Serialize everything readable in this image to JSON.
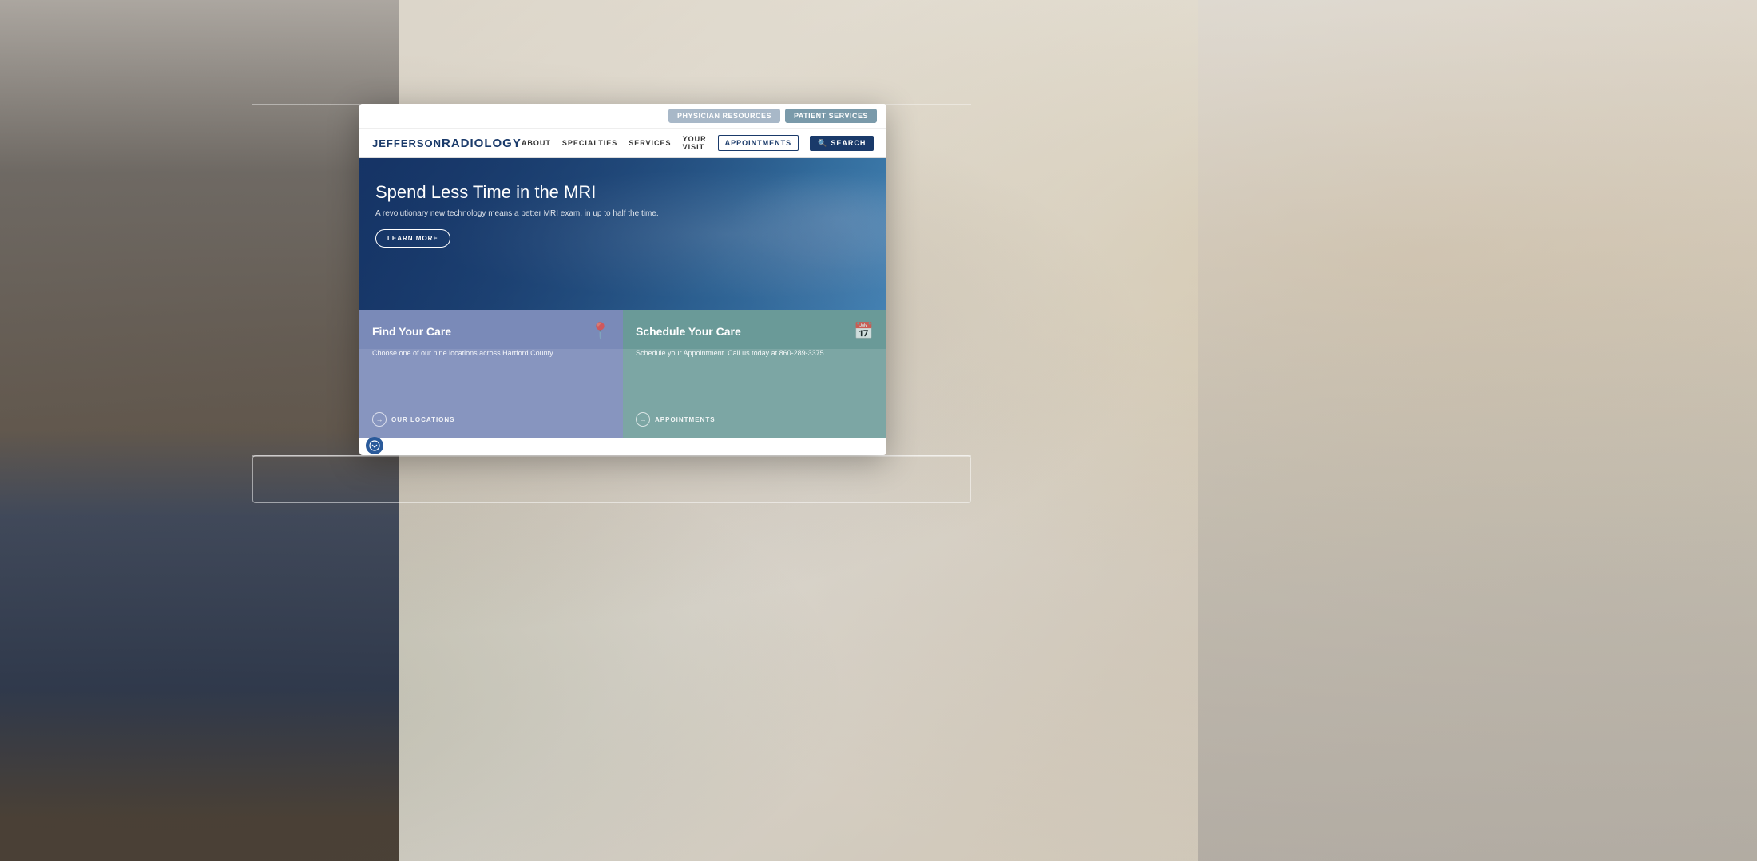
{
  "utility_bar": {
    "physician_resources_label": "PHYSICIAN RESOURCES",
    "patient_services_label": "PATiENT Services"
  },
  "nav": {
    "logo_jefferson": "Jefferson",
    "logo_radiology": "Radiology",
    "links": [
      {
        "label": "ABOUT"
      },
      {
        "label": "SPECIALTIES"
      },
      {
        "label": "SERVICES"
      },
      {
        "label": "YOUR VISIT"
      }
    ],
    "appointments_label": "APPOINTMENTS",
    "search_label": "SEARCH"
  },
  "hero": {
    "title": "Spend Less Time in the MRI",
    "subtitle": "A revolutionary new technology means a better MRI exam, in up to half the time.",
    "cta_label": "LEARN MORE"
  },
  "card_find": {
    "title": "Find Your Care",
    "body": "Choose one of our nine locations across Hartford County.",
    "link_label": "OUR LOCATIONS",
    "icon": "📍"
  },
  "card_schedule": {
    "title": "Schedule Your Care",
    "body": "Schedule your Appointment. Call us today at 860-289-3375.",
    "link_label": "APPOINTMENTS",
    "icon": "📅"
  }
}
